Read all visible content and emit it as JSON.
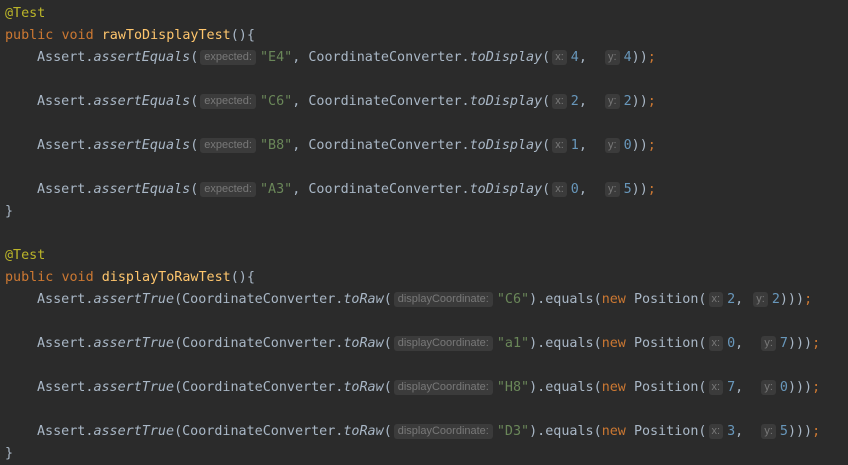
{
  "colors": {
    "background": "#2b2b2b",
    "default_text": "#a9b7c6",
    "annotation": "#bbb529",
    "keyword": "#cc7832",
    "method_declaration": "#ffc66d",
    "string": "#6a8759",
    "number": "#6897bb",
    "hint_text": "#787878",
    "hint_background": "#3b3b3b"
  },
  "code": {
    "annotation": "@Test",
    "kw_public": "public",
    "kw_void": "void",
    "kw_new": "new",
    "open_brace": "(){",
    "close_brace": "}",
    "method1_name": "rawToDisplayTest",
    "method2_name": "displayToRawTest",
    "assert_class": "Assert.",
    "assert_equals": "assertEquals",
    "assert_true": "assertTrue",
    "converter": "CoordinateConverter.",
    "to_display": "toDisplay",
    "to_raw": "toRaw",
    "equals_call": ").equals(",
    "position_class": "Position(",
    "hint_expected": "expected:",
    "hint_x": "x:",
    "hint_y": "y:",
    "hint_display_coord": "displayCoordinate:",
    "raw_tests": [
      {
        "expected": "\"E4\"",
        "x": "4",
        "y": "4"
      },
      {
        "expected": "\"C6\"",
        "x": "2",
        "y": "2"
      },
      {
        "expected": "\"B8\"",
        "x": "1",
        "y": "0"
      },
      {
        "expected": "\"A3\"",
        "x": "0",
        "y": "5"
      }
    ],
    "display_tests": [
      {
        "coord": "\"C6\"",
        "x": "2",
        "y": "2"
      },
      {
        "coord": "\"a1\"",
        "x": "0",
        "y": "7"
      },
      {
        "coord": "\"H8\"",
        "x": "7",
        "y": "0"
      },
      {
        "coord": "\"D3\"",
        "x": "3",
        "y": "5"
      }
    ]
  }
}
